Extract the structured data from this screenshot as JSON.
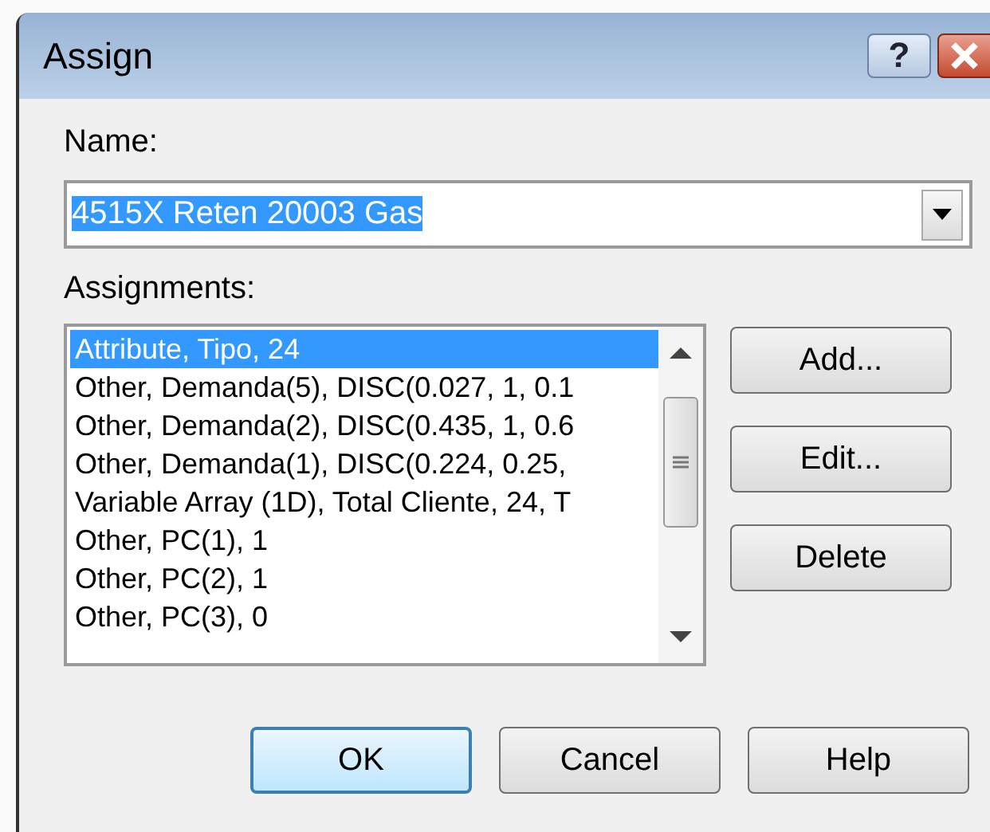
{
  "window": {
    "title": "Assign",
    "help_button": "?"
  },
  "name": {
    "label": "Name:",
    "value": "4515X Reten 20003 Gas",
    "text_selected": true
  },
  "assignments": {
    "label": "Assignments:",
    "items": [
      {
        "text": "Attribute, Tipo, 24",
        "selected": true
      },
      {
        "text": "Other, Demanda(5), DISC(0.027, 1, 0.1",
        "selected": false
      },
      {
        "text": "Other, Demanda(2), DISC(0.435, 1, 0.6",
        "selected": false
      },
      {
        "text": "Other, Demanda(1), DISC(0.224, 0.25, ",
        "selected": false
      },
      {
        "text": "Variable Array (1D), Total Cliente, 24, T",
        "selected": false
      },
      {
        "text": "Other, PC(1), 1",
        "selected": false
      },
      {
        "text": "Other, PC(2), 1",
        "selected": false
      },
      {
        "text": "Other, PC(3), 0",
        "selected": false
      }
    ]
  },
  "side_buttons": [
    "Add...",
    "Edit...",
    "Delete"
  ],
  "buttons": [
    {
      "label": "OK",
      "default": true
    },
    {
      "label": "Cancel",
      "default": false
    },
    {
      "label": "Help",
      "default": false
    }
  ]
}
